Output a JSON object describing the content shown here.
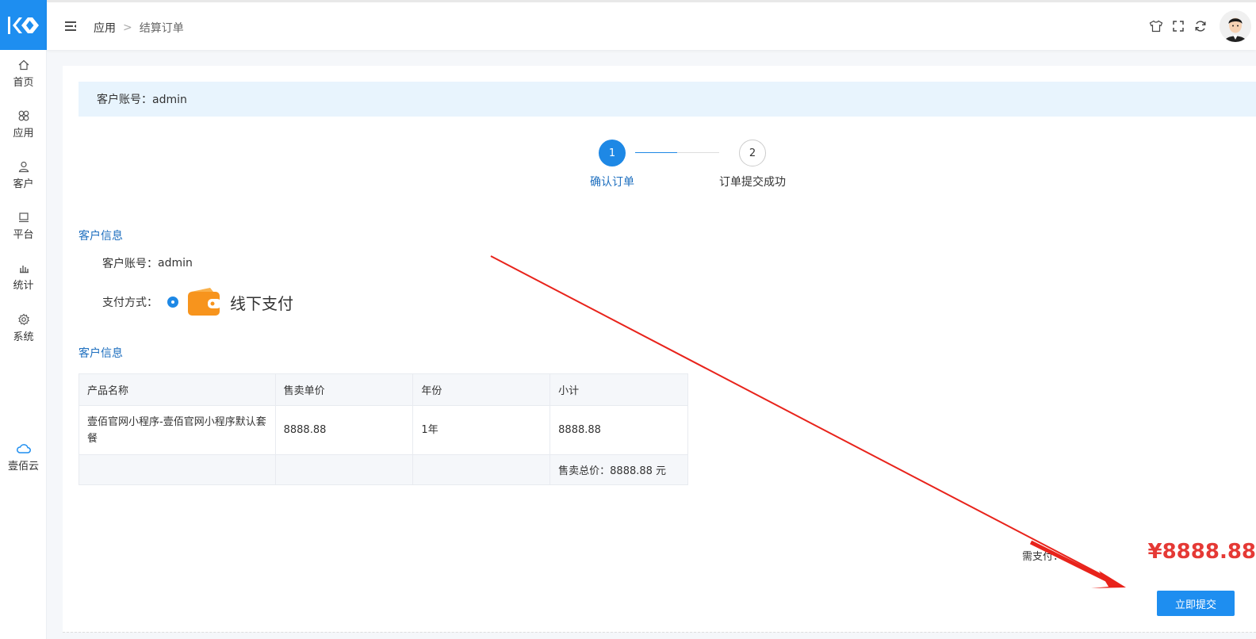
{
  "sidebar": {
    "items": [
      {
        "label": "首页",
        "icon": "home-icon"
      },
      {
        "label": "应用",
        "icon": "apps-icon"
      },
      {
        "label": "客户",
        "icon": "user-icon"
      },
      {
        "label": "平台",
        "icon": "monitor-icon"
      },
      {
        "label": "统计",
        "icon": "bar-chart-icon"
      },
      {
        "label": "系统",
        "icon": "gear-icon"
      }
    ],
    "cloud": {
      "label": "壹佰云",
      "icon": "cloud-icon"
    }
  },
  "breadcrumb": {
    "root": "应用",
    "separator": ">",
    "current": "结算订单"
  },
  "info_bar": {
    "text": "客户账号：admin"
  },
  "steps": [
    {
      "number": "1",
      "label": "确认订单"
    },
    {
      "number": "2",
      "label": "订单提交成功"
    }
  ],
  "customer_section": {
    "title": "客户信息",
    "account_label": "客户账号：",
    "account_value": "admin",
    "payment_label": "支付方式：",
    "payment_option": "线下支付"
  },
  "product_section": {
    "title": "客户信息",
    "columns": [
      "产品名称",
      "售卖单价",
      "年份",
      "小计"
    ],
    "rows": [
      {
        "name": "壹佰官网小程序-壹佰官网小程序默认套餐",
        "price": "8888.88",
        "years": "1年",
        "subtotal": "8888.88"
      }
    ],
    "total_label": "售卖总价：8888.88 元"
  },
  "payment": {
    "need_label": "需支付：",
    "amount": "¥8888.88"
  },
  "submit_label": "立即提交",
  "colors": {
    "primary": "#1e8ef0",
    "amount": "#e53935",
    "arrow": "#e8231b"
  }
}
